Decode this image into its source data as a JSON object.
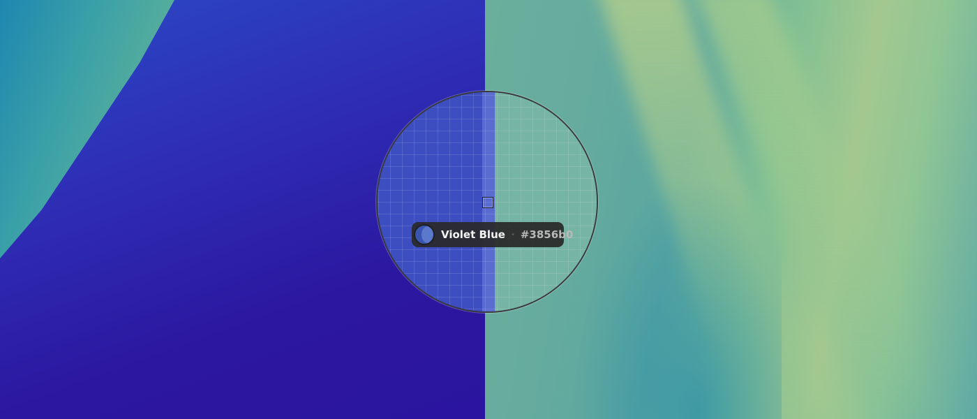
{
  "color_picker": {
    "color_name": "Violet Blue",
    "separator": "•",
    "hex_value": "#3856b0",
    "swatch_color": "#3856b0",
    "swatch_icon": "color-swatch-icon"
  },
  "loupe": {
    "target_icon": "crosshair-square-icon"
  },
  "colors": {
    "wallpaper_blue": "#2e2fb6",
    "wallpaper_green": "#76b4a6",
    "readout_bg": "#282828"
  }
}
